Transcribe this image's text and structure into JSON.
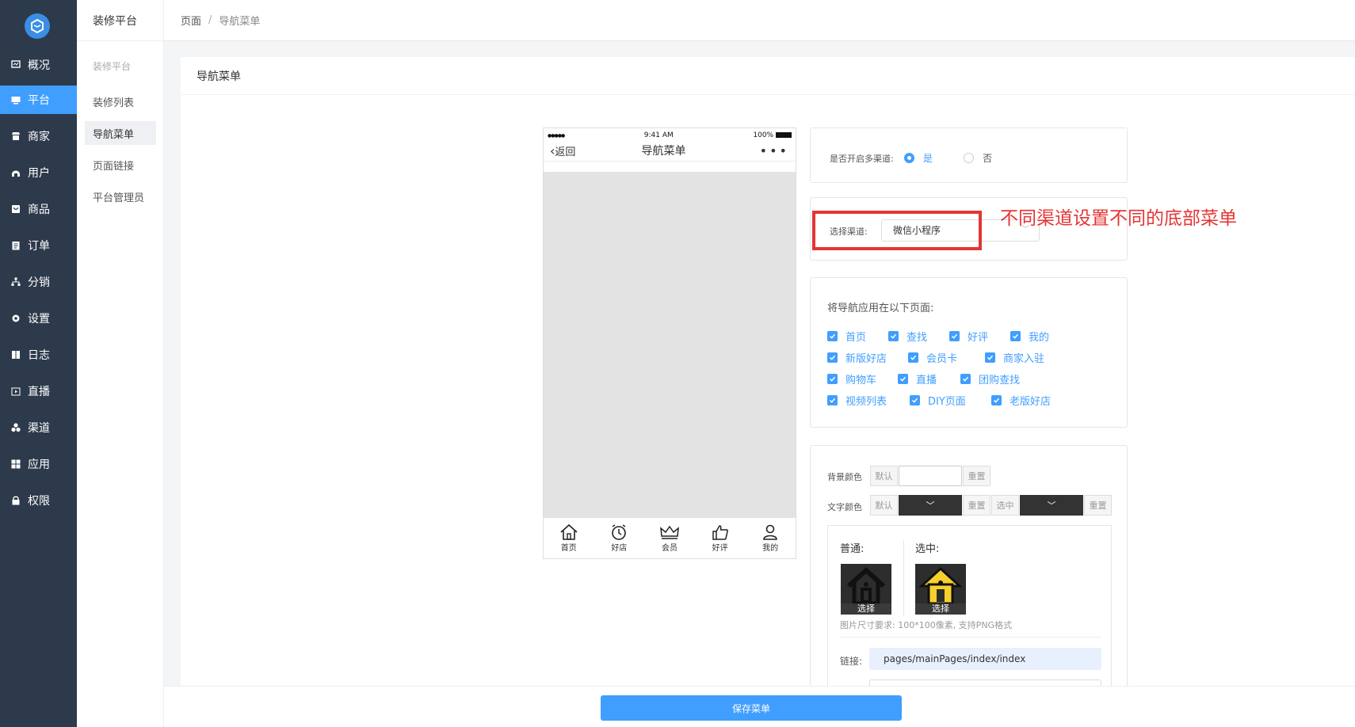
{
  "sidebar": {
    "items": [
      {
        "label": "概况",
        "icon": "monitor-icon"
      },
      {
        "label": "平台",
        "icon": "desktop-icon"
      },
      {
        "label": "商家",
        "icon": "store-icon"
      },
      {
        "label": "用户",
        "icon": "user-icon"
      },
      {
        "label": "商品",
        "icon": "bag-icon"
      },
      {
        "label": "订单",
        "icon": "clipboard-icon"
      },
      {
        "label": "分销",
        "icon": "tree-icon"
      },
      {
        "label": "设置",
        "icon": "gear-icon"
      },
      {
        "label": "日志",
        "icon": "book-icon"
      },
      {
        "label": "直播",
        "icon": "play-icon"
      },
      {
        "label": "渠道",
        "icon": "cluster-icon"
      },
      {
        "label": "应用",
        "icon": "grid-icon"
      },
      {
        "label": "权限",
        "icon": "lock-icon"
      }
    ],
    "active": "平台",
    "accent": "#409eff"
  },
  "subnav": {
    "title": "装修平台",
    "group": "装修平台",
    "items": [
      "装修列表",
      "导航菜单",
      "页面链接",
      "平台管理员"
    ],
    "active": "导航菜单"
  },
  "breadcrumb": {
    "root": "页面",
    "sep": "/",
    "current": "导航菜单"
  },
  "card": {
    "title": "导航菜单"
  },
  "phone": {
    "signal": "●●●●●",
    "time": "9:41 AM",
    "battery": "100%",
    "back": "返回",
    "title": "导航菜单",
    "more": "•••",
    "tabs": [
      {
        "label": "首页",
        "icon": "home-icon"
      },
      {
        "label": "好店",
        "icon": "alarm-clock-icon"
      },
      {
        "label": "会员",
        "icon": "crown-icon"
      },
      {
        "label": "好评",
        "icon": "thumbs-up-icon"
      },
      {
        "label": "我的",
        "icon": "person-icon"
      }
    ]
  },
  "multichannel": {
    "label": "是否开启多渠道:",
    "yes": "是",
    "no": "否",
    "selected": "是"
  },
  "channel": {
    "label": "选择渠道:",
    "value": "微信小程序"
  },
  "annotation": "不同渠道设置不同的底部菜单",
  "pages": {
    "label": "将导航应用在以下页面:",
    "rows": [
      [
        "首页",
        "查找",
        "好评",
        "我的"
      ],
      [
        "新版好店",
        "会员卡",
        "商家入驻"
      ],
      [
        "购物车",
        "直播",
        "团购查找"
      ],
      [
        "视频列表",
        "DIY页面",
        "老版好店"
      ]
    ]
  },
  "colors": {
    "bg_label": "背景颜色",
    "default": "默认",
    "reset": "重置",
    "text_label": "文字颜色",
    "selected": "选中"
  },
  "icons": {
    "normal": "普通:",
    "selected": "选中:",
    "choose": "选择",
    "hint": "图片尺寸要求: 100*100像素, 支持PNG格式"
  },
  "link": {
    "label": "链接:",
    "value": "pages/mainPages/index/index"
  },
  "save": "保存菜单"
}
